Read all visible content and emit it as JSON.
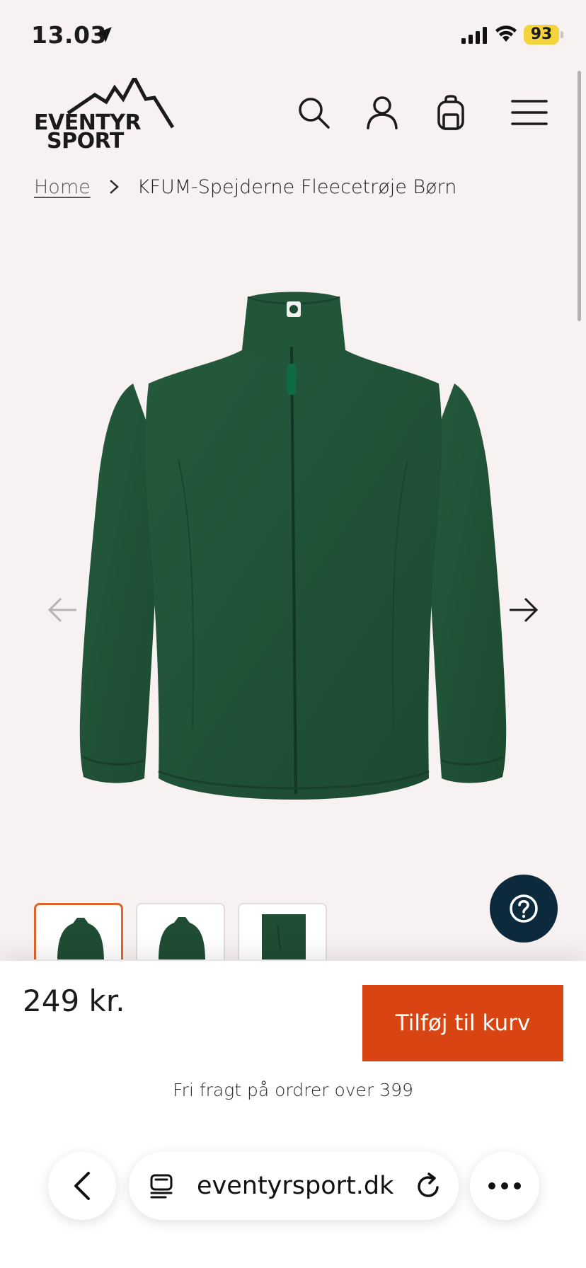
{
  "status_bar": {
    "time": "13.03",
    "battery": "93"
  },
  "header": {
    "logo_line1": "EVENTYR",
    "logo_line2": "SPORT",
    "icons": [
      "search-icon",
      "user-icon",
      "bag-icon",
      "menu-icon"
    ]
  },
  "breadcrumb": {
    "home": "Home",
    "current": "KFUM-Spejderne Fleecetrøje Børn"
  },
  "product": {
    "image_alt": "green-fleece-jacket",
    "thumbnail_count": 3,
    "color": "#1f4d33"
  },
  "purchase": {
    "price": "249 kr.",
    "add_to_cart": "Tilføj til kurv",
    "free_shipping": "Fri fragt på ordrer over 399"
  },
  "browser": {
    "url": "eventyrsport.dk"
  },
  "colors": {
    "accent": "#d84512",
    "help_button": "#0d2a3d",
    "background": "#f7f1f1"
  }
}
